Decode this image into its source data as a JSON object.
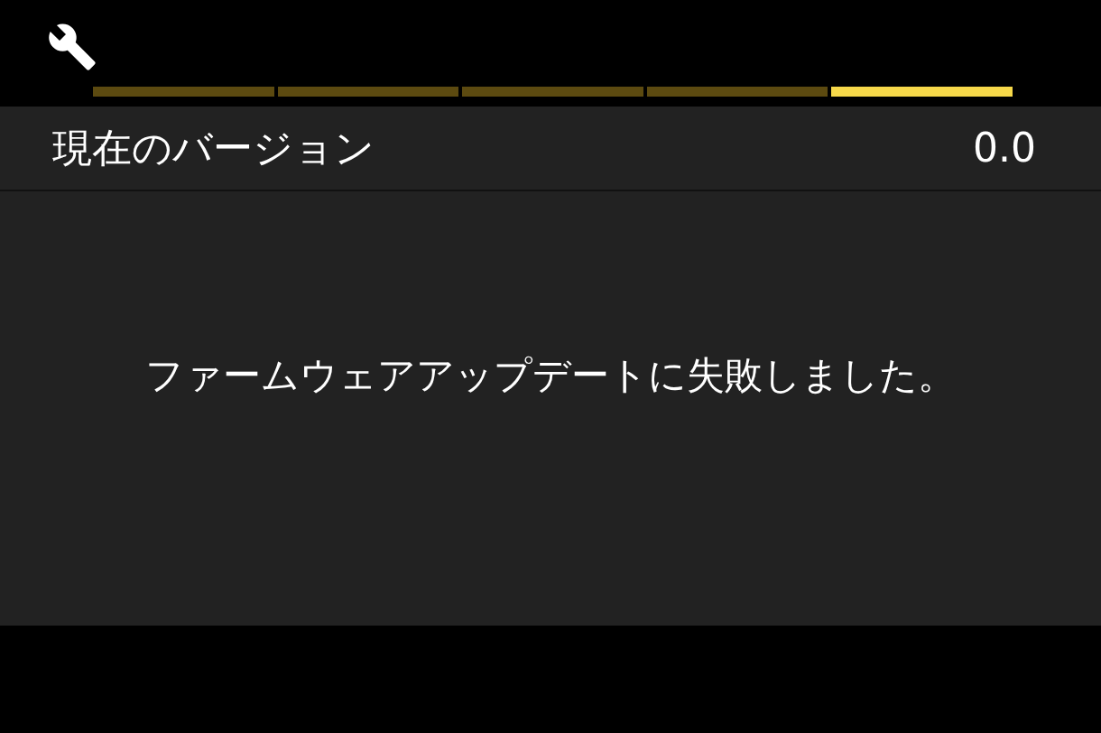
{
  "pages": [
    {
      "selected": false
    },
    {
      "selected": false
    },
    {
      "selected": false
    },
    {
      "selected": false
    },
    {
      "selected": true
    }
  ],
  "version_row": {
    "label": "現在のバージョン",
    "value": "0.0"
  },
  "message": "ファームウェアアップデートに失敗しました。"
}
